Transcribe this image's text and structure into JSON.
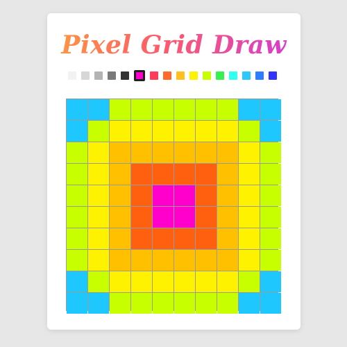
{
  "app": {
    "title": "Pixel Grid Draw"
  },
  "palette": {
    "selected_index": 5,
    "colors": [
      "#f2f2f2",
      "#d7d7d7",
      "#b3b3b3",
      "#7a7a7a",
      "#333333",
      "#ff00cc",
      "#ff3b5c",
      "#ff6a2b",
      "#ffbf1f",
      "#fff200",
      "#c8ff00",
      "#35f04f",
      "#33fff0",
      "#2cc7ff",
      "#2e7dff",
      "#3333ff"
    ]
  },
  "canvas": {
    "rows": 10,
    "cols": 10,
    "cells": [
      [
        "#1ec8ff",
        "#1ec8ff",
        "#c8ff00",
        "#c8ff00",
        "#c8ff00",
        "#c8ff00",
        "#c8ff00",
        "#c8ff00",
        "#1ec8ff",
        "#1ec8ff"
      ],
      [
        "#1ec8ff",
        "#c8ff00",
        "#fff200",
        "#fff200",
        "#fff200",
        "#fff200",
        "#fff200",
        "#fff200",
        "#c8ff00",
        "#1ec8ff"
      ],
      [
        "#c8ff00",
        "#fff200",
        "#ffc000",
        "#ffc000",
        "#ffc000",
        "#ffc000",
        "#ffc000",
        "#ffc000",
        "#fff200",
        "#c8ff00"
      ],
      [
        "#c8ff00",
        "#fff200",
        "#ffc000",
        "#ff6010",
        "#ff6010",
        "#ff6010",
        "#ff6010",
        "#ffc000",
        "#fff200",
        "#c8ff00"
      ],
      [
        "#c8ff00",
        "#fff200",
        "#ffc000",
        "#ff6010",
        "#ff00cc",
        "#ff00cc",
        "#ff6010",
        "#ffc000",
        "#fff200",
        "#c8ff00"
      ],
      [
        "#c8ff00",
        "#fff200",
        "#ffc000",
        "#ff6010",
        "#ff00cc",
        "#ff00cc",
        "#ff6010",
        "#ffc000",
        "#fff200",
        "#c8ff00"
      ],
      [
        "#c8ff00",
        "#fff200",
        "#ffc000",
        "#ff6010",
        "#ff6010",
        "#ff6010",
        "#ff6010",
        "#ffc000",
        "#fff200",
        "#c8ff00"
      ],
      [
        "#c8ff00",
        "#fff200",
        "#ffc000",
        "#ffc000",
        "#ffc000",
        "#ffc000",
        "#ffc000",
        "#ffc000",
        "#fff200",
        "#c8ff00"
      ],
      [
        "#1ec8ff",
        "#c8ff00",
        "#fff200",
        "#fff200",
        "#fff200",
        "#fff200",
        "#fff200",
        "#fff200",
        "#c8ff00",
        "#1ec8ff"
      ],
      [
        "#1ec8ff",
        "#1ec8ff",
        "#c8ff00",
        "#c8ff00",
        "#c8ff00",
        "#c8ff00",
        "#c8ff00",
        "#c8ff00",
        "#1ec8ff",
        "#1ec8ff"
      ]
    ]
  }
}
